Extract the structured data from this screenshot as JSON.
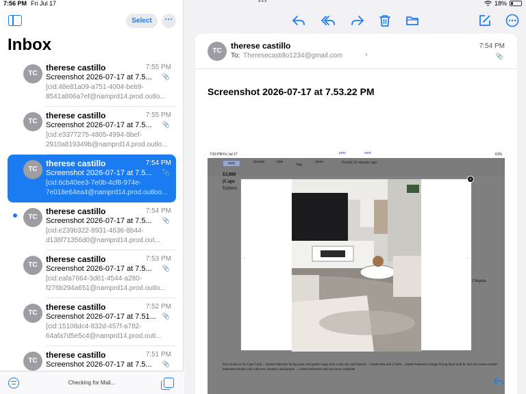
{
  "status_bar": {
    "time": "7:56 PM",
    "date": "Fri Jul 17",
    "battery": "18%",
    "battery_level": 0.18
  },
  "sidebar": {
    "select_label": "Select",
    "more_label": "···",
    "title": "Inbox",
    "status_text": "Checking for Mail..."
  },
  "messages": [
    {
      "initials": "TC",
      "sender": "therese castillo",
      "time": "7:55 PM",
      "subject": "Screenshot 2026-07-17 at 7.5...",
      "preview": "[cid:48e81a09-a751-4004-beb9-8541a806a7ef@namprd14.prod.outlo...",
      "unread": false,
      "selected": false
    },
    {
      "initials": "TC",
      "sender": "therese castillo",
      "time": "7:55 PM",
      "subject": "Screenshot 2026-07-17 at 7.5...",
      "preview": "[cid:e3377275-4805-4994-8bef-2910a819349b@namprd14.prod.outlo...",
      "unread": false,
      "selected": false
    },
    {
      "initials": "TC",
      "sender": "therese castillo",
      "time": "7:54 PM",
      "subject": "Screenshot 2026-07-17 at 7.5...",
      "preview": "[cid:6cb40ee3-7e0b-4cf8-974e-7e018e64ea4@namprd14.prod.outloo...",
      "unread": false,
      "selected": true
    },
    {
      "initials": "TC",
      "sender": "therese castillo",
      "time": "7:54 PM",
      "subject": "Screenshot 2026-07-17 at 7.5...",
      "preview": "[cid:e239b322-8931-4636-8b44-d138f71356d0@namprd14.prod.out...",
      "unread": true,
      "selected": false
    },
    {
      "initials": "TC",
      "sender": "therese castillo",
      "time": "7:53 PM",
      "subject": "Screenshot 2026-07-17 at 7.5...",
      "preview": "[cid:eafa7664-3d61-4544-a280-f276b294a651@namprd14.prod.outlo...",
      "unread": false,
      "selected": false
    },
    {
      "initials": "TC",
      "sender": "therese castillo",
      "time": "7:52 PM",
      "subject": "Screenshot 2026-07-17 at 7.51...",
      "preview": "[cid:15108dc4-832d-457f-a782-64afa7d5e5c4@namprd14.prod.outl...",
      "unread": false,
      "selected": false
    },
    {
      "initials": "TC",
      "sender": "therese castillo",
      "time": "7:51 PM",
      "subject": "Screenshot 2026-07-17 at 7.5...",
      "preview": "",
      "unread": false,
      "selected": false
    }
  ],
  "detail": {
    "initials": "TC",
    "from": "therese castillo",
    "to_label": "To:",
    "to_address": "Theresecastillo1234@gmail.com",
    "time": "7:54 PM",
    "subject": "Screenshot 2026-07-17 at 7.53.22 PM"
  },
  "embedded": {
    "status_left": "7:53 PM   Fri Jul 17",
    "status_right": "61%",
    "reply": "reply",
    "favorite": "favorite",
    "hide": "hide",
    "flag": "flag",
    "share": "share",
    "prev": "prev",
    "next": "next",
    "posted": "Posted 24 minutes ago",
    "price": "$3,000",
    "location": "(Cape",
    "embers": "Embers",
    "chiquita": "Chiquita",
    "footer": "Nice house in Se Cape Coral .. master bedroom facing lanai and garden huge pool ) only the yard fenced .. 3 bedrooms and 2 baths .. master bedroom is huge facing lanai with he and she closets master bathroom double sink with new counters and granite .. 2 more bedrooms and one more complete"
  },
  "colors": {
    "accent": "#1a7cf0",
    "selected_row": "#1a7cf0",
    "avatar": "#9d9da3"
  }
}
